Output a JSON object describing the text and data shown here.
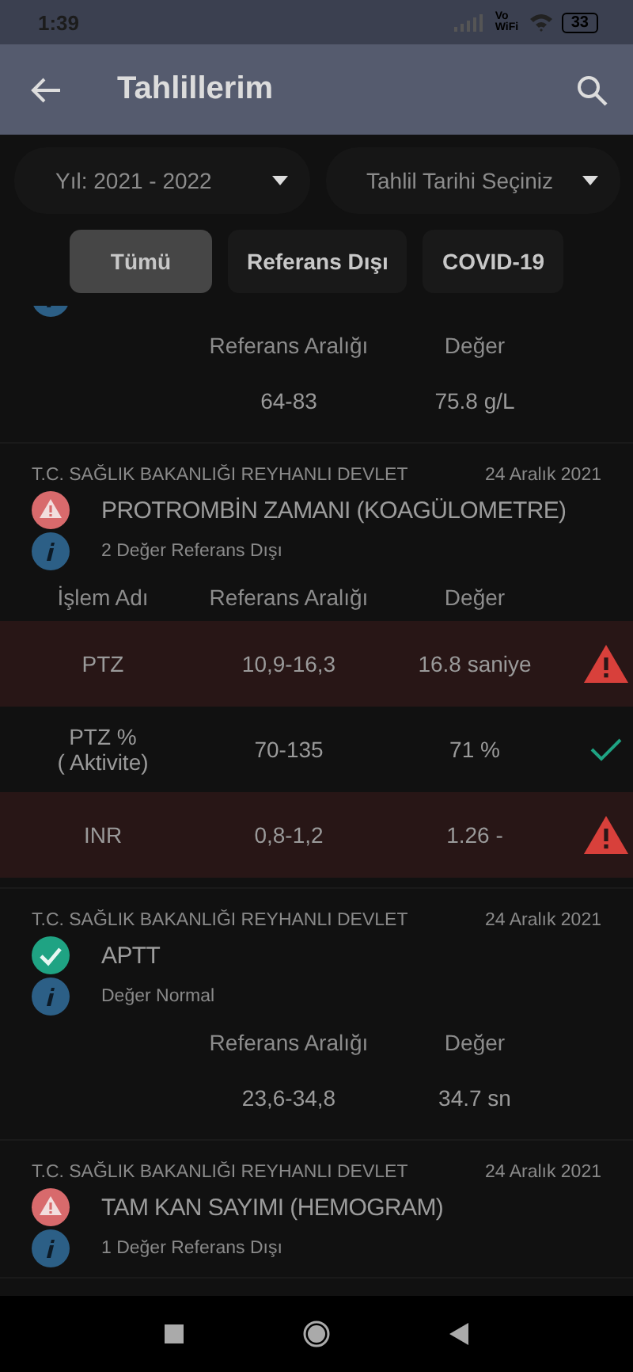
{
  "status_bar": {
    "time": "1:39",
    "network_label": "Vo WiFi",
    "battery": "33"
  },
  "app_bar": {
    "title": "Tahlillerim"
  },
  "filters": [
    {
      "value": "Yıl: 2021 - 2022"
    },
    {
      "placeholder": "Tahlil Tarihi Seçiniz"
    }
  ],
  "chips": [
    {
      "label": "Tümü",
      "selected": true
    },
    {
      "label": "Referans Dışı",
      "selected": false
    },
    {
      "label": "COVID-19",
      "selected": false
    }
  ],
  "results": [
    {
      "kind": "clipped",
      "columns": [
        "Referans Aralığı",
        "Değer"
      ],
      "rows": [
        {
          "range": "64-83",
          "value": "75.8 g/L"
        }
      ]
    },
    {
      "kind": "full",
      "hospital": "T.C. SAĞLIK BAKANLIĞI REYHANLI DEVLET",
      "date": "24 Aralık 2021",
      "title": "PROTROMBİN ZAMANI (KOAGÜLOMETRE)",
      "out_of_range": true,
      "summary": "2 Değer Referans Dışı",
      "columns": [
        "İşlem Adı",
        "Referans Aralığı",
        "Değer"
      ],
      "rows": [
        {
          "name": "PTZ",
          "range": "10,9-16,3",
          "value": "16.8 saniye",
          "out_of_range": true
        },
        {
          "name": "PTZ %\n( Aktivite)",
          "range": "70-135",
          "value": "71 %",
          "out_of_range": false
        },
        {
          "name": "INR",
          "range": "0,8-1,2",
          "value": "1.26 -",
          "out_of_range": true
        }
      ]
    },
    {
      "kind": "full",
      "hospital": "T.C. SAĞLIK BAKANLIĞI REYHANLI DEVLET",
      "date": "24 Aralık 2021",
      "title": "APTT",
      "out_of_range": false,
      "summary": "Değer Normal",
      "columns": [
        "Referans Aralığı",
        "Değer"
      ],
      "rows": [
        {
          "range": "23,6-34,8",
          "value": "34.7 sn"
        }
      ]
    },
    {
      "kind": "full",
      "hospital": "T.C. SAĞLIK BAKANLIĞI REYHANLI DEVLET",
      "date": "24 Aralık 2021",
      "title": "TAM KAN SAYIMI (HEMOGRAM)",
      "out_of_range": true,
      "summary": "1 Değer Referans Dışı"
    }
  ]
}
